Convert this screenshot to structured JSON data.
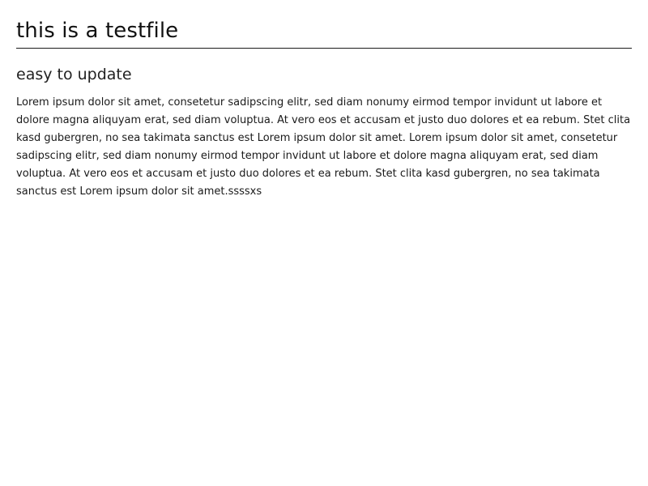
{
  "document": {
    "title": "this is a testfile",
    "subtitle": "easy to update",
    "paragraph": "Lorem ipsum dolor sit amet, consetetur sadipscing elitr, sed diam nonumy eirmod tempor invidunt ut labore et dolore magna aliquyam erat, sed diam voluptua. At vero eos et accusam et justo duo dolores et ea rebum. Stet clita kasd gubergren, no sea takimata sanctus est Lorem ipsum dolor sit amet. Lorem ipsum dolor sit amet, consetetur sadipscing elitr, sed diam nonumy eirmod tempor invidunt ut labore et dolore magna aliquyam erat, sed diam voluptua. At vero eos et accusam et justo duo dolores et ea rebum. Stet clita kasd gubergren, no sea takimata sanctus est Lorem ipsum dolor sit amet.ssssxs"
  }
}
